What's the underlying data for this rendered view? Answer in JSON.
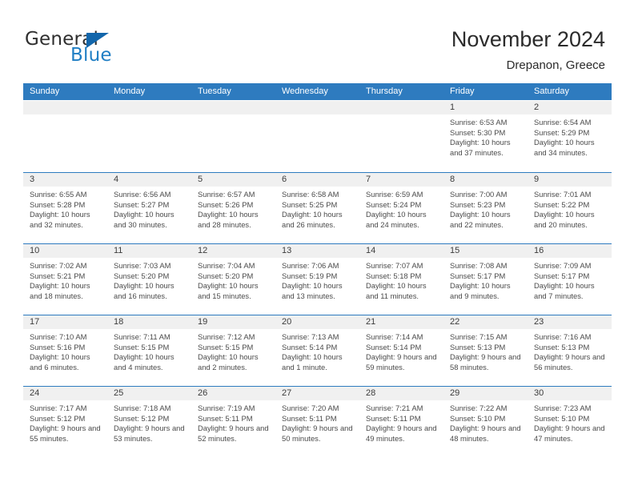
{
  "brand": {
    "name_primary": "General",
    "name_secondary": "Blue",
    "accent_color": "#1266ab",
    "secondary_color": "#1f7ec4"
  },
  "header": {
    "title": "November 2024",
    "subtitle": "Drepanon, Greece"
  },
  "calendar": {
    "header_bg": "#2e7bbf",
    "day_band_bg": "#f0f0f0",
    "weekdays": [
      "Sunday",
      "Monday",
      "Tuesday",
      "Wednesday",
      "Thursday",
      "Friday",
      "Saturday"
    ],
    "weeks": [
      [
        {
          "day": "",
          "empty": true
        },
        {
          "day": "",
          "empty": true
        },
        {
          "day": "",
          "empty": true
        },
        {
          "day": "",
          "empty": true
        },
        {
          "day": "",
          "empty": true
        },
        {
          "day": "1",
          "sunrise": "Sunrise: 6:53 AM",
          "sunset": "Sunset: 5:30 PM",
          "daylight": "Daylight: 10 hours and 37 minutes."
        },
        {
          "day": "2",
          "sunrise": "Sunrise: 6:54 AM",
          "sunset": "Sunset: 5:29 PM",
          "daylight": "Daylight: 10 hours and 34 minutes."
        }
      ],
      [
        {
          "day": "3",
          "sunrise": "Sunrise: 6:55 AM",
          "sunset": "Sunset: 5:28 PM",
          "daylight": "Daylight: 10 hours and 32 minutes."
        },
        {
          "day": "4",
          "sunrise": "Sunrise: 6:56 AM",
          "sunset": "Sunset: 5:27 PM",
          "daylight": "Daylight: 10 hours and 30 minutes."
        },
        {
          "day": "5",
          "sunrise": "Sunrise: 6:57 AM",
          "sunset": "Sunset: 5:26 PM",
          "daylight": "Daylight: 10 hours and 28 minutes."
        },
        {
          "day": "6",
          "sunrise": "Sunrise: 6:58 AM",
          "sunset": "Sunset: 5:25 PM",
          "daylight": "Daylight: 10 hours and 26 minutes."
        },
        {
          "day": "7",
          "sunrise": "Sunrise: 6:59 AM",
          "sunset": "Sunset: 5:24 PM",
          "daylight": "Daylight: 10 hours and 24 minutes."
        },
        {
          "day": "8",
          "sunrise": "Sunrise: 7:00 AM",
          "sunset": "Sunset: 5:23 PM",
          "daylight": "Daylight: 10 hours and 22 minutes."
        },
        {
          "day": "9",
          "sunrise": "Sunrise: 7:01 AM",
          "sunset": "Sunset: 5:22 PM",
          "daylight": "Daylight: 10 hours and 20 minutes."
        }
      ],
      [
        {
          "day": "10",
          "sunrise": "Sunrise: 7:02 AM",
          "sunset": "Sunset: 5:21 PM",
          "daylight": "Daylight: 10 hours and 18 minutes."
        },
        {
          "day": "11",
          "sunrise": "Sunrise: 7:03 AM",
          "sunset": "Sunset: 5:20 PM",
          "daylight": "Daylight: 10 hours and 16 minutes."
        },
        {
          "day": "12",
          "sunrise": "Sunrise: 7:04 AM",
          "sunset": "Sunset: 5:20 PM",
          "daylight": "Daylight: 10 hours and 15 minutes."
        },
        {
          "day": "13",
          "sunrise": "Sunrise: 7:06 AM",
          "sunset": "Sunset: 5:19 PM",
          "daylight": "Daylight: 10 hours and 13 minutes."
        },
        {
          "day": "14",
          "sunrise": "Sunrise: 7:07 AM",
          "sunset": "Sunset: 5:18 PM",
          "daylight": "Daylight: 10 hours and 11 minutes."
        },
        {
          "day": "15",
          "sunrise": "Sunrise: 7:08 AM",
          "sunset": "Sunset: 5:17 PM",
          "daylight": "Daylight: 10 hours and 9 minutes."
        },
        {
          "day": "16",
          "sunrise": "Sunrise: 7:09 AM",
          "sunset": "Sunset: 5:17 PM",
          "daylight": "Daylight: 10 hours and 7 minutes."
        }
      ],
      [
        {
          "day": "17",
          "sunrise": "Sunrise: 7:10 AM",
          "sunset": "Sunset: 5:16 PM",
          "daylight": "Daylight: 10 hours and 6 minutes."
        },
        {
          "day": "18",
          "sunrise": "Sunrise: 7:11 AM",
          "sunset": "Sunset: 5:15 PM",
          "daylight": "Daylight: 10 hours and 4 minutes."
        },
        {
          "day": "19",
          "sunrise": "Sunrise: 7:12 AM",
          "sunset": "Sunset: 5:15 PM",
          "daylight": "Daylight: 10 hours and 2 minutes."
        },
        {
          "day": "20",
          "sunrise": "Sunrise: 7:13 AM",
          "sunset": "Sunset: 5:14 PM",
          "daylight": "Daylight: 10 hours and 1 minute."
        },
        {
          "day": "21",
          "sunrise": "Sunrise: 7:14 AM",
          "sunset": "Sunset: 5:14 PM",
          "daylight": "Daylight: 9 hours and 59 minutes."
        },
        {
          "day": "22",
          "sunrise": "Sunrise: 7:15 AM",
          "sunset": "Sunset: 5:13 PM",
          "daylight": "Daylight: 9 hours and 58 minutes."
        },
        {
          "day": "23",
          "sunrise": "Sunrise: 7:16 AM",
          "sunset": "Sunset: 5:13 PM",
          "daylight": "Daylight: 9 hours and 56 minutes."
        }
      ],
      [
        {
          "day": "24",
          "sunrise": "Sunrise: 7:17 AM",
          "sunset": "Sunset: 5:12 PM",
          "daylight": "Daylight: 9 hours and 55 minutes."
        },
        {
          "day": "25",
          "sunrise": "Sunrise: 7:18 AM",
          "sunset": "Sunset: 5:12 PM",
          "daylight": "Daylight: 9 hours and 53 minutes."
        },
        {
          "day": "26",
          "sunrise": "Sunrise: 7:19 AM",
          "sunset": "Sunset: 5:11 PM",
          "daylight": "Daylight: 9 hours and 52 minutes."
        },
        {
          "day": "27",
          "sunrise": "Sunrise: 7:20 AM",
          "sunset": "Sunset: 5:11 PM",
          "daylight": "Daylight: 9 hours and 50 minutes."
        },
        {
          "day": "28",
          "sunrise": "Sunrise: 7:21 AM",
          "sunset": "Sunset: 5:11 PM",
          "daylight": "Daylight: 9 hours and 49 minutes."
        },
        {
          "day": "29",
          "sunrise": "Sunrise: 7:22 AM",
          "sunset": "Sunset: 5:10 PM",
          "daylight": "Daylight: 9 hours and 48 minutes."
        },
        {
          "day": "30",
          "sunrise": "Sunrise: 7:23 AM",
          "sunset": "Sunset: 5:10 PM",
          "daylight": "Daylight: 9 hours and 47 minutes."
        }
      ]
    ]
  }
}
